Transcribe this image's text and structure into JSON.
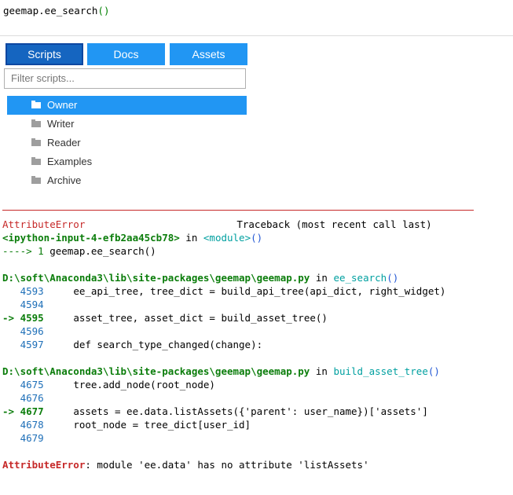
{
  "input_cell": {
    "code_prefix": "geemap.ee_search",
    "code_parens": "()"
  },
  "tabs": [
    {
      "label": "Scripts",
      "active": true
    },
    {
      "label": "Docs",
      "active": false
    },
    {
      "label": "Assets",
      "active": false
    }
  ],
  "filter": {
    "placeholder": "Filter scripts..."
  },
  "tree": [
    {
      "label": "Owner",
      "selected": true
    },
    {
      "label": "Writer",
      "selected": false
    },
    {
      "label": "Reader",
      "selected": false
    },
    {
      "label": "Examples",
      "selected": false
    },
    {
      "label": "Archive",
      "selected": false
    }
  ],
  "traceback": {
    "error_name": "AttributeError",
    "traceback_label": "Traceback (most recent call last)",
    "input_ref": "<ipython-input-4-efb2aa45cb78>",
    "in_word": " in ",
    "module_ref": "<module>",
    "module_parens": "()",
    "arrow_line_arrow": "----> 1",
    "arrow_line_code": " geemap.ee_search()",
    "frame1": {
      "path": "D:\\soft\\Anaconda3\\lib\\site-packages\\geemap\\geemap.py",
      "in_word": " in ",
      "func": "ee_search",
      "parens": "()",
      "lines": [
        {
          "num": "   4593",
          "code": "     ee_api_tree, tree_dict = build_api_tree(api_dict, right_widget)"
        },
        {
          "num": "   4594",
          "code": ""
        },
        {
          "num": "-> 4595",
          "code": "     asset_tree, asset_dict = build_asset_tree()"
        },
        {
          "num": "   4596",
          "code": ""
        },
        {
          "num": "   4597",
          "code": "     def search_type_changed(change):"
        }
      ]
    },
    "frame2": {
      "path": "D:\\soft\\Anaconda3\\lib\\site-packages\\geemap\\geemap.py",
      "in_word": " in ",
      "func": "build_asset_tree",
      "parens": "()",
      "lines": [
        {
          "num": "   4675",
          "code": "     tree.add_node(root_node)"
        },
        {
          "num": "   4676",
          "code": ""
        },
        {
          "num": "-> 4677",
          "code": "     assets = ee.data.listAssets({'parent': user_name})['assets']"
        },
        {
          "num": "   4678",
          "code": "     root_node = tree_dict[user_id]"
        },
        {
          "num": "   4679",
          "code": ""
        }
      ]
    },
    "final_error": "AttributeError",
    "final_message": ": module 'ee.data' has no attribute 'listAssets'"
  },
  "colors": {
    "tab_blue": "#2196F3",
    "tab_active": "#1565C0",
    "error_red": "#c62828",
    "green": "#0b7d0b",
    "teal": "#00a0a0"
  }
}
